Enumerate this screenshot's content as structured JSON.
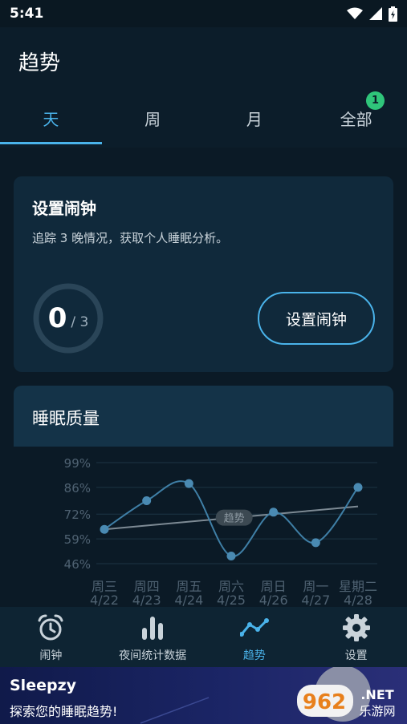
{
  "status": {
    "time": "5:41"
  },
  "header": {
    "title": "趋势"
  },
  "tabs": [
    {
      "label": "天",
      "active": true
    },
    {
      "label": "周",
      "active": false
    },
    {
      "label": "月",
      "active": false
    },
    {
      "label": "全部",
      "active": false,
      "badge": "1"
    }
  ],
  "alarm_card": {
    "title": "设置闹钟",
    "description": "追踪 3 晚情况，获取个人睡眠分析。",
    "progress_current": "0",
    "progress_total": "/ 3",
    "button_label": "设置闹钟"
  },
  "quality_card": {
    "title": "睡眠质量"
  },
  "chart_data": {
    "type": "line",
    "categories": [
      "周三",
      "周四",
      "周五",
      "周六",
      "周日",
      "周一",
      "星期二"
    ],
    "dates": [
      "4/22",
      "4/23",
      "4/24",
      "4/25",
      "4/26",
      "4/27",
      "4/28"
    ],
    "series": [
      {
        "values": [
          64,
          79,
          88,
          50,
          73,
          57,
          86
        ],
        "color": "#3f7fa6"
      }
    ],
    "trend": {
      "label": "趋势",
      "start": 64,
      "end": 76,
      "color": "#7d8a94"
    },
    "y_ticks": [
      "99%",
      "86%",
      "72%",
      "59%",
      "46%"
    ],
    "y_tick_values": [
      99,
      86,
      72,
      59,
      46
    ],
    "ylim": [
      46,
      99
    ],
    "grid": true
  },
  "bottom_nav": [
    {
      "label": "闹钟",
      "icon": "alarm-clock-icon",
      "active": false
    },
    {
      "label": "夜间统计数据",
      "icon": "bar-chart-icon",
      "active": false
    },
    {
      "label": "趋势",
      "icon": "trend-line-icon",
      "active": true
    },
    {
      "label": "设置",
      "icon": "gear-icon",
      "active": false
    }
  ],
  "ad": {
    "title": "Sleepzy",
    "subtitle": "探索您的睡眠趋势!",
    "logo_number": "962",
    "logo_domain": ".NET",
    "logo_text": "乐游网"
  },
  "colors": {
    "accent": "#4ab3ea",
    "background": "#0b1a26",
    "card": "#10293b",
    "badge": "#2fc57a"
  }
}
